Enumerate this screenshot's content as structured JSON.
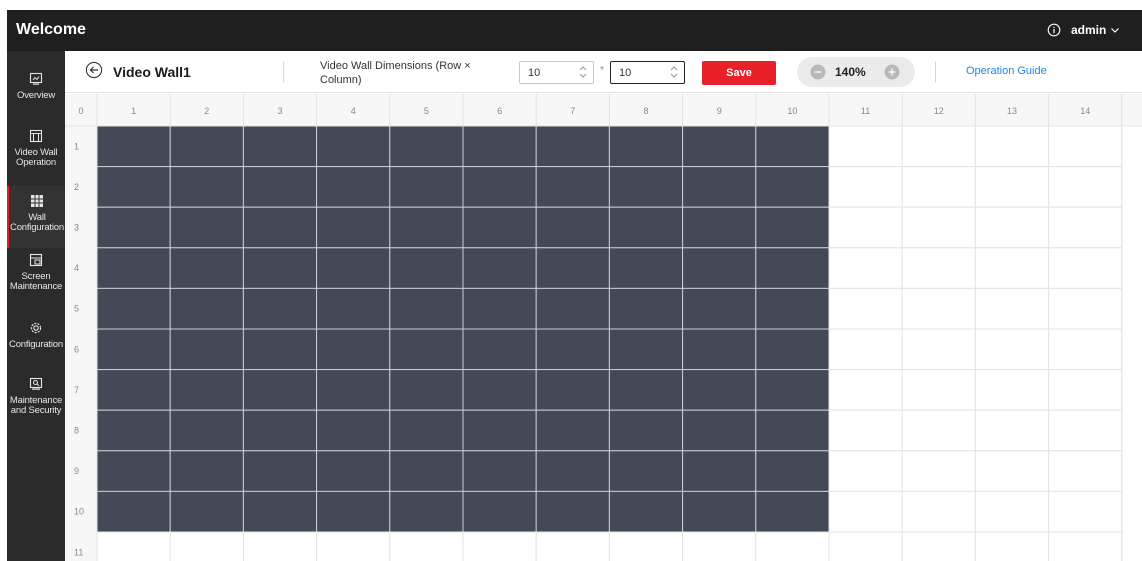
{
  "header": {
    "title": "Welcome",
    "user": "admin"
  },
  "sidebar": {
    "items": [
      {
        "label": "Overview",
        "icon": "overview-icon",
        "active": false
      },
      {
        "label": "Video Wall Operation",
        "icon": "video-wall-operation-icon",
        "active": false
      },
      {
        "label": "Wall Configuration",
        "icon": "wall-configuration-icon",
        "active": true
      },
      {
        "label": "Screen Maintenance",
        "icon": "screen-maintenance-icon",
        "active": false
      },
      {
        "label": "Configuration",
        "icon": "gear-icon",
        "active": false
      },
      {
        "label": "Maintenance and Security",
        "icon": "maintenance-security-icon",
        "active": false
      }
    ]
  },
  "toolbar": {
    "wall_name": "Video Wall1",
    "dimensions_label": "Video Wall Dimensions (Row × Column)",
    "rows": "10",
    "columns": "10",
    "separator": "*",
    "save_label": "Save",
    "zoom_value": "140%",
    "guide_label": "Operation Guide"
  },
  "grid": {
    "origin_label": "0",
    "column_labels": [
      "1",
      "2",
      "3",
      "4",
      "5",
      "6",
      "7",
      "8",
      "9",
      "10",
      "11",
      "12",
      "13",
      "14"
    ],
    "row_labels": [
      "1",
      "2",
      "3",
      "4",
      "5",
      "6",
      "7",
      "8",
      "9",
      "10",
      "11"
    ],
    "filled_rows": 10,
    "filled_columns": 10
  },
  "colors": {
    "topbar": "#1f1f1f",
    "sidebar": "#2b2b2b",
    "accent_red": "#e7202a",
    "screen_fill": "#434a55",
    "grid_line": "#e3e3e3",
    "link_blue": "#1e88e5"
  }
}
